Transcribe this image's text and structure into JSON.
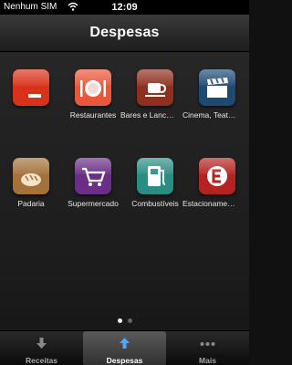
{
  "status_bar": {
    "carrier": "Nenhum SIM",
    "time": "12:09"
  },
  "header": {
    "title": "Despesas"
  },
  "grid": {
    "items": [
      {
        "label": "",
        "icon": "red-minus-icon",
        "color": "#d9321b"
      },
      {
        "label": "Restaurantes",
        "icon": "plate-cutlery-icon",
        "color": "#e9573a"
      },
      {
        "label": "Bares e Lanc…",
        "icon": "coffee-cup-icon",
        "color": "#8e3020"
      },
      {
        "label": "Cinema, Teat…",
        "icon": "clapperboard-icon",
        "color": "#1d4a73"
      },
      {
        "label": "Padaria",
        "icon": "bread-icon",
        "color": "#a5713a"
      },
      {
        "label": "Supermercado",
        "icon": "shopping-cart-icon",
        "color": "#6a2e86"
      },
      {
        "label": "Combustíveis",
        "icon": "fuel-pump-icon",
        "color": "#2a8c83"
      },
      {
        "label": "Estacioname…",
        "icon": "parking-e-icon",
        "color": "#b52222"
      }
    ]
  },
  "page_indicator": {
    "current_page": 1,
    "total_pages": 2
  },
  "tab_bar": {
    "tabs": [
      {
        "label": "Receitas",
        "icon": "arrow-down-icon",
        "selected": false
      },
      {
        "label": "Despesas",
        "icon": "arrow-up-icon",
        "selected": true
      },
      {
        "label": "Mais",
        "icon": "more-dots-icon",
        "selected": false
      }
    ]
  }
}
